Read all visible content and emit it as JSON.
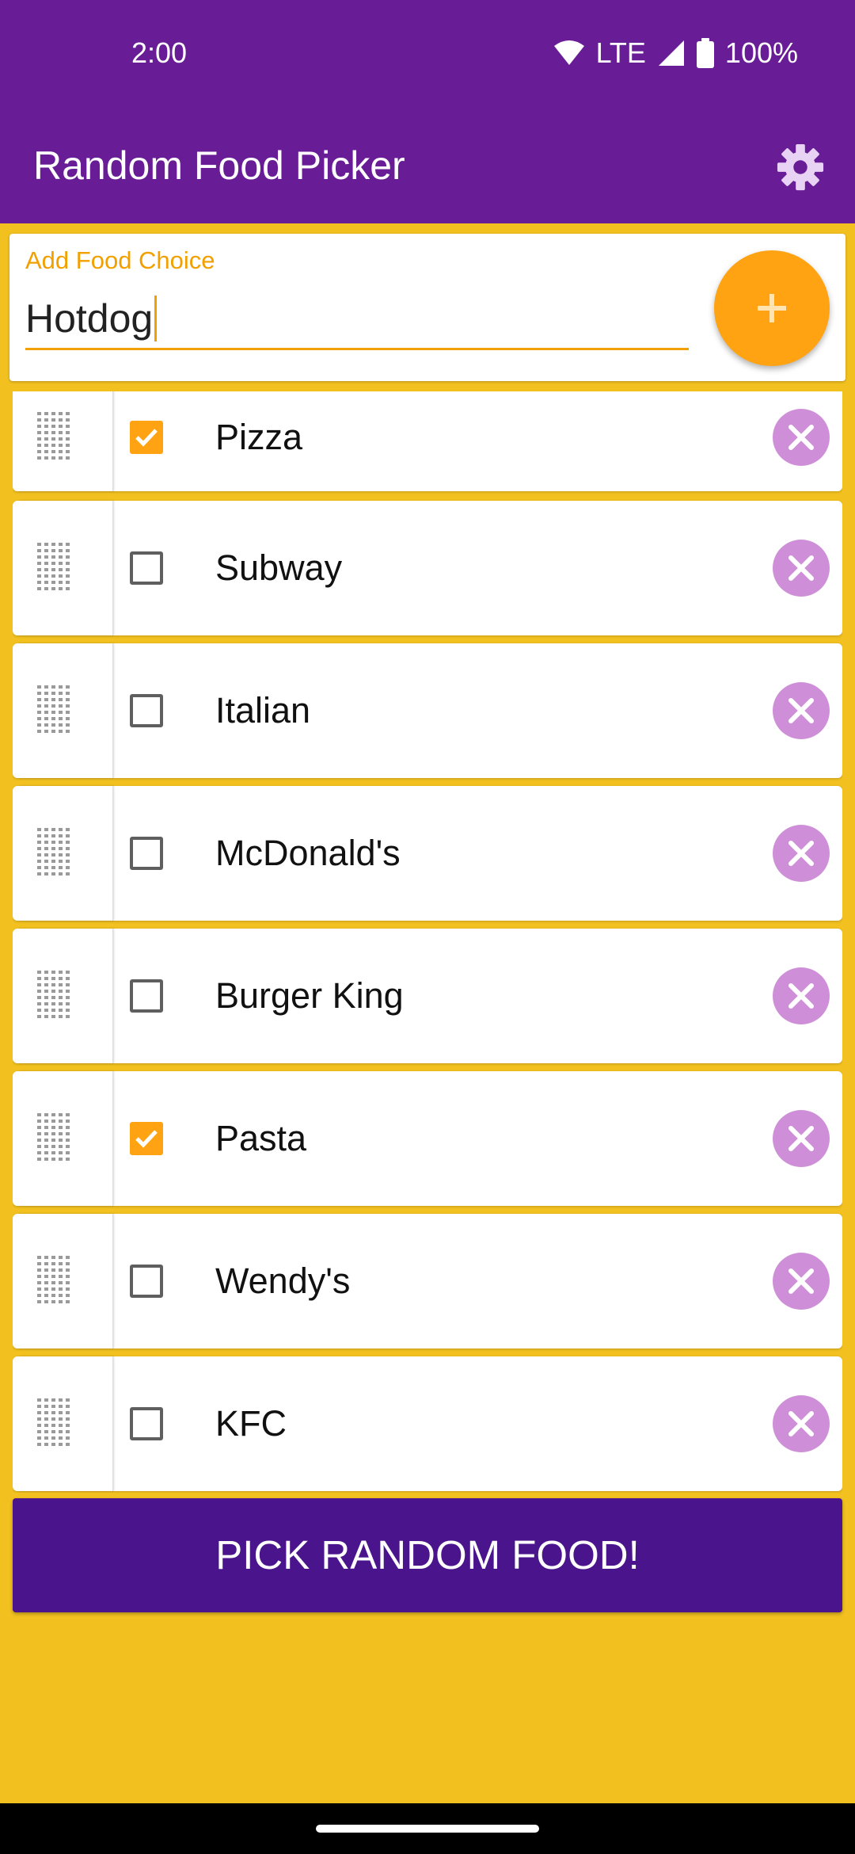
{
  "status_bar": {
    "time": "2:00",
    "network": "LTE",
    "battery": "100%"
  },
  "app_bar": {
    "title": "Random Food Picker",
    "settings_icon": "gear-icon"
  },
  "input": {
    "label": "Add Food Choice",
    "value": "Hotdog",
    "add_icon": "plus-icon"
  },
  "foods": [
    {
      "label": "Pizza",
      "checked": true
    },
    {
      "label": "Subway",
      "checked": false
    },
    {
      "label": "Italian",
      "checked": false
    },
    {
      "label": "McDonald's",
      "checked": false
    },
    {
      "label": "Burger King",
      "checked": false
    },
    {
      "label": "Pasta",
      "checked": true
    },
    {
      "label": "Wendy's",
      "checked": false
    },
    {
      "label": "KFC",
      "checked": false
    }
  ],
  "pick_button": {
    "label": "PICK RANDOM FOOD!"
  },
  "colors": {
    "primary": "#681C96",
    "background": "#F2C120",
    "accent": "#FFA312",
    "delete": "#CF8FD8",
    "button": "#4A148C"
  }
}
